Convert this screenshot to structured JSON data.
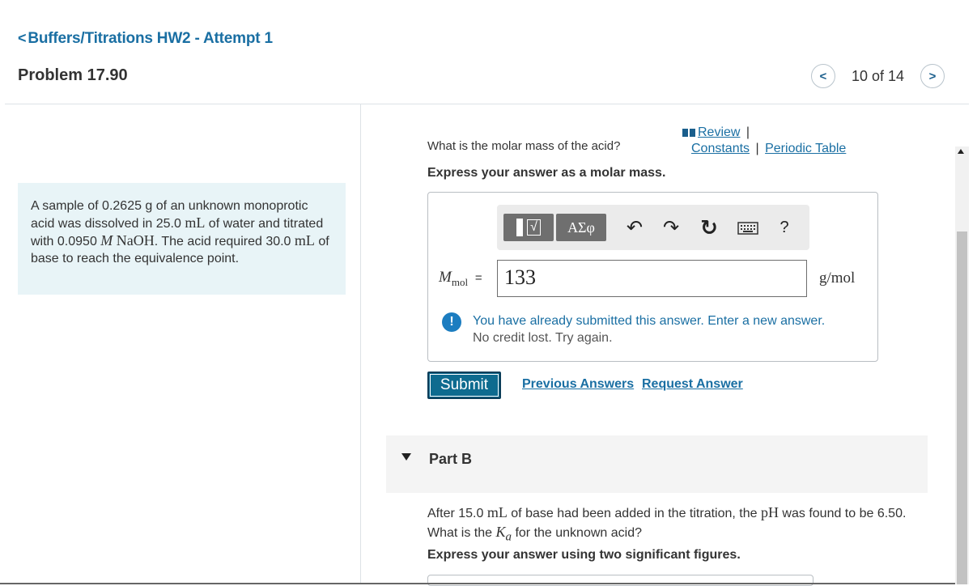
{
  "header": {
    "back_chevron": "<",
    "back_label": "Buffers/Titrations HW2 - Attempt 1",
    "problem_title": "Problem 17.90",
    "pager_prev": "<",
    "pager_text": "10 of 14",
    "pager_next": ">"
  },
  "problem_statement": {
    "p1": "A sample of 0.2625 g of an unknown monoprotic acid was dissolved in 25.0",
    "u1": "mL",
    "p2": "of water and titrated with 0.0950",
    "m": "M",
    "naoh": "NaOH",
    "p3": ". The acid required 30.0",
    "u2": "mL",
    "p4": "of base to reach the equivalence point."
  },
  "links": {
    "review": "Review",
    "sep": "|",
    "constants": "Constants",
    "periodic_table": "Periodic Table"
  },
  "part_a": {
    "question": "What is the molar mass of the acid?",
    "express": "Express your answer as a molar mass.",
    "toolbar": {
      "templates_label": "√",
      "greek_label": "ΑΣφ",
      "undo_label": "↶",
      "redo_label": "↷",
      "reset_label": "↻",
      "help_label": "?"
    },
    "variable_symbol": "M",
    "variable_sub": "mol",
    "equals": "=",
    "answer_value": "133",
    "units": "g/mol",
    "feedback_icon": "!",
    "feedback_line1": "You have already submitted this answer. Enter a new answer.",
    "feedback_line2": "No credit lost. Try again.",
    "submit_label": "Submit",
    "previous_answers_label": "Previous Answers",
    "request_answer_label": "Request Answer"
  },
  "part_b": {
    "label": "Part B",
    "q1": "After 15.0",
    "u1": "mL",
    "q2": "of base had been added in the titration, the",
    "ph": "pH",
    "q3": "was found to be 6.50. What is the",
    "ka_k": "K",
    "ka_sub": "a",
    "q4": "for the unknown acid?",
    "express": "Express your answer using two significant figures."
  },
  "colors": {
    "link": "#1a6fa3",
    "submit_bg": "#0e6b8f",
    "problem_box_bg": "#e8f4f7",
    "feedback_icon_bg": "#1c7dc0"
  }
}
